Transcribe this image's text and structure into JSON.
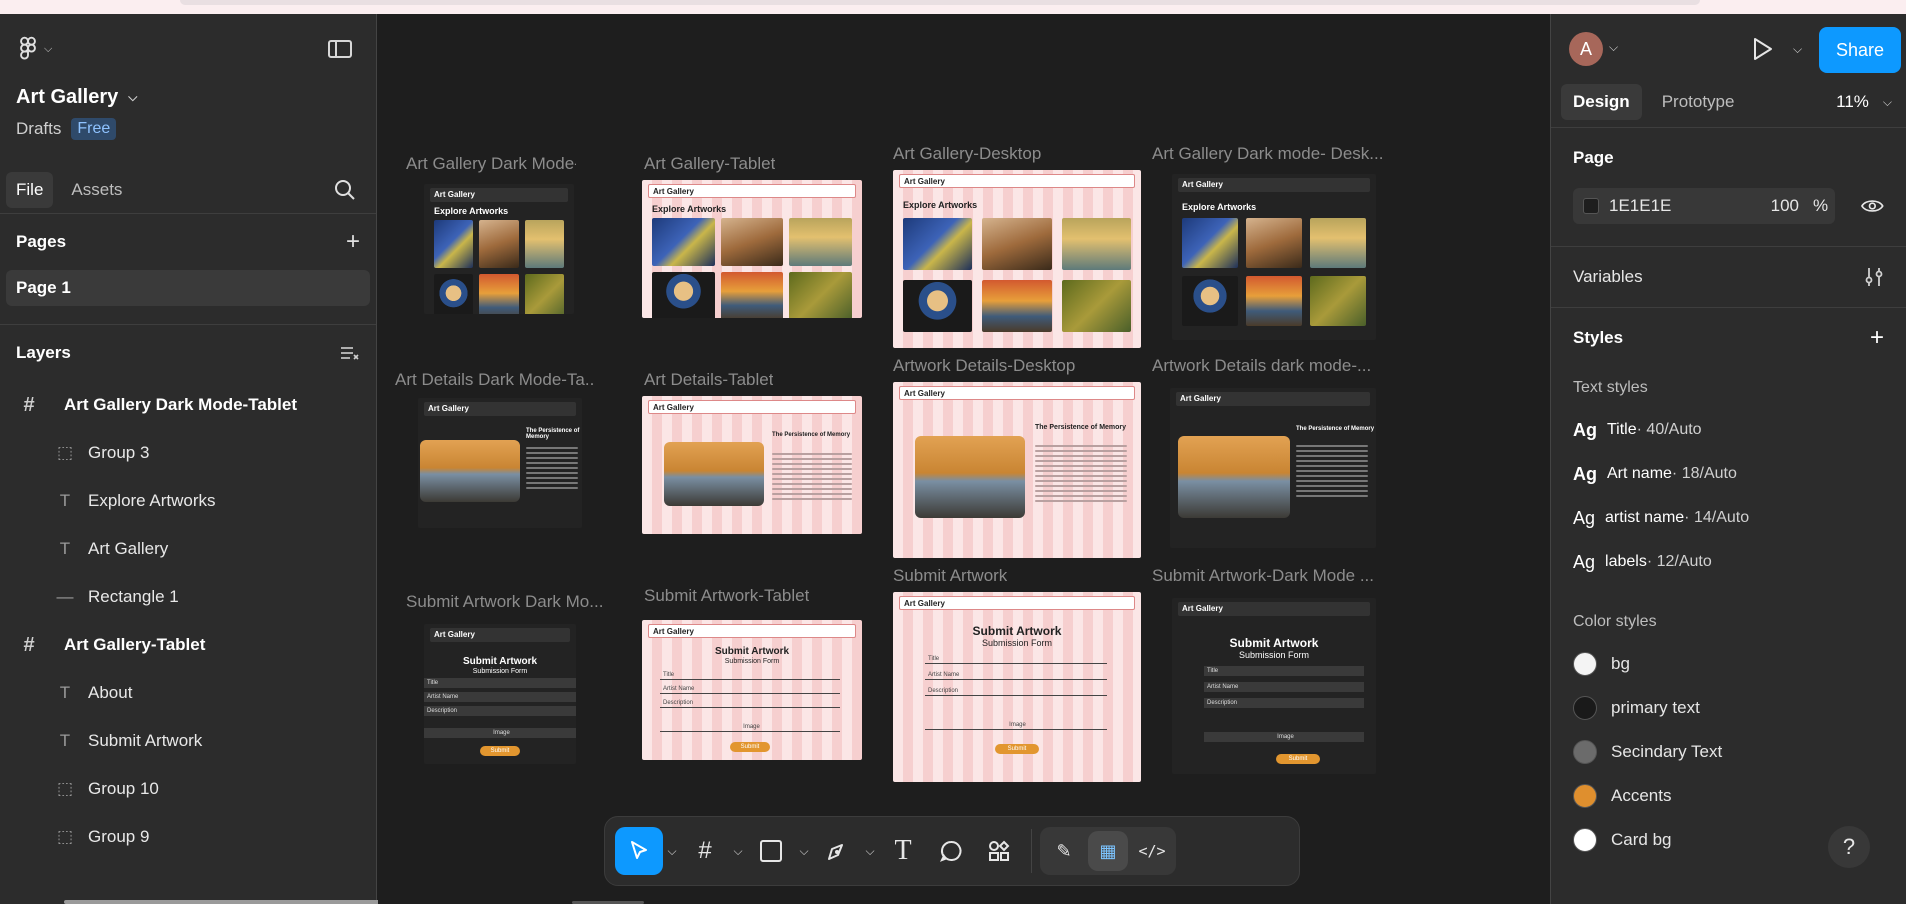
{
  "file": {
    "title": "Art Gallery",
    "location": "Drafts",
    "plan_badge": "Free"
  },
  "left_tabs": [
    "File",
    "Assets"
  ],
  "pages": {
    "header": "Pages",
    "items": [
      "Page 1"
    ]
  },
  "layers": {
    "header": "Layers",
    "items": [
      {
        "type": "frame",
        "name": "Art Gallery Dark Mode-Tablet"
      },
      {
        "type": "group",
        "name": "Group 3"
      },
      {
        "type": "text",
        "name": "Explore Artworks"
      },
      {
        "type": "text",
        "name": "Art Gallery"
      },
      {
        "type": "rect",
        "name": "Rectangle 1"
      },
      {
        "type": "frame",
        "name": "Art Gallery-Tablet"
      },
      {
        "type": "text",
        "name": "About"
      },
      {
        "type": "text",
        "name": "Submit Artwork"
      },
      {
        "type": "group",
        "name": "Group 10"
      },
      {
        "type": "group",
        "name": "Group 9"
      }
    ]
  },
  "canvas_frames": {
    "labels": [
      "Art Gallery Dark Mode-T...",
      "Art Gallery-Tablet",
      "Art Gallery-Desktop",
      "Art Gallery Dark mode- Desk...",
      "Art Details Dark Mode-Ta...",
      "Art Details-Tablet",
      "Artwork Details-Desktop",
      "Artwork Details dark mode-...",
      "Submit Artwork Dark Mo...",
      "Submit Artwork-Tablet",
      "Submit Artwork",
      "Submit Artwork-Dark Mode ..."
    ],
    "mock": {
      "brand": "Art Gallery",
      "explore": "Explore Artworks",
      "detail_title": "The Persistence of Memory",
      "detail_artist": "By Salvador Dali",
      "form_title": "Submit Artwork",
      "form_sub": "Submission Form",
      "field_title": "Title",
      "field_artist": "Artist Name",
      "field_desc": "Description",
      "field_image": "Image",
      "submit": "Submit"
    }
  },
  "toolbar": {
    "tools": [
      "move-tool",
      "frame-tool",
      "shape-tool",
      "pen-tool",
      "text-tool",
      "comment-tool",
      "actions-tool"
    ],
    "modes": [
      "draw-mode",
      "design-mode",
      "dev-mode"
    ]
  },
  "right_panel": {
    "avatar_letter": "A",
    "share_label": "Share",
    "tabs": [
      "Design",
      "Prototype"
    ],
    "zoom": "11%",
    "page_header": "Page",
    "page_bg_hex": "1E1E1E",
    "page_bg_opacity": "100",
    "percent_sign": "%",
    "variables_header": "Variables",
    "styles_header": "Styles",
    "text_styles_header": "Text styles",
    "text_styles": [
      {
        "ag": "Ag",
        "name": "Title",
        "spec": " · 40/Auto"
      },
      {
        "ag": "Ag",
        "name": "Art name",
        "spec": " · 18/Auto"
      },
      {
        "ag": "Ag",
        "name": "artist name",
        "spec": " · 14/Auto"
      },
      {
        "ag": "Ag",
        "name": "labels",
        "spec": " · 12/Auto"
      }
    ],
    "color_styles_header": "Color styles",
    "color_styles": [
      {
        "name": "bg",
        "color": "#f4f4f4"
      },
      {
        "name": "primary text",
        "color": "#1a1a1a"
      },
      {
        "name": "Secindary Text",
        "color": "#6b6b6b"
      },
      {
        "name": "Accents",
        "color": "#df8f2e"
      },
      {
        "name": "Card bg",
        "color": "#ffffff"
      }
    ],
    "help": "?"
  }
}
